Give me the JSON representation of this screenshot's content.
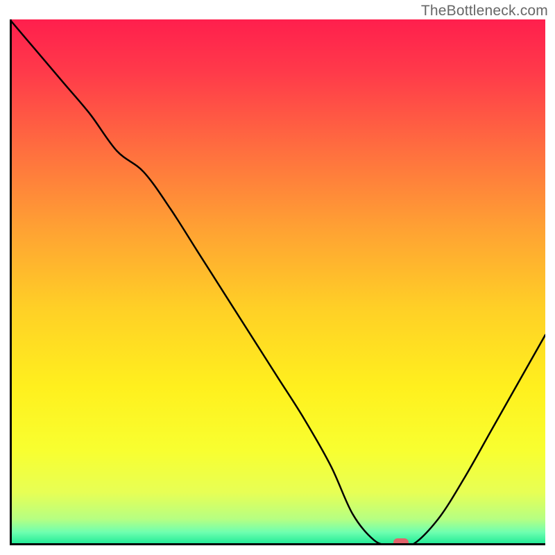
{
  "watermark": "TheBottleneck.com",
  "chart_data": {
    "type": "line",
    "title": "",
    "xlabel": "",
    "ylabel": "",
    "xlim": [
      0,
      100
    ],
    "ylim": [
      0,
      100
    ],
    "x": [
      0,
      5,
      10,
      15,
      20,
      25,
      30,
      35,
      40,
      45,
      50,
      55,
      60,
      64,
      68,
      71,
      75,
      80,
      85,
      90,
      95,
      100
    ],
    "values": [
      100,
      94,
      88,
      82,
      75,
      71,
      64,
      56,
      48,
      40,
      32,
      24,
      15,
      6,
      1,
      0,
      0,
      5,
      13,
      22,
      31,
      40
    ],
    "optimal_x": 73,
    "gradient_stops": [
      {
        "offset": 0.0,
        "color": "#ff1f4d"
      },
      {
        "offset": 0.1,
        "color": "#ff3a4a"
      },
      {
        "offset": 0.25,
        "color": "#ff6f3f"
      },
      {
        "offset": 0.4,
        "color": "#ffa233"
      },
      {
        "offset": 0.55,
        "color": "#ffd026"
      },
      {
        "offset": 0.7,
        "color": "#fff01e"
      },
      {
        "offset": 0.82,
        "color": "#f8ff30"
      },
      {
        "offset": 0.9,
        "color": "#e7ff55"
      },
      {
        "offset": 0.95,
        "color": "#b6ff82"
      },
      {
        "offset": 0.975,
        "color": "#6fffb0"
      },
      {
        "offset": 1.0,
        "color": "#18e893"
      }
    ],
    "marker_color": "#e1636b",
    "curve_color": "#000000"
  }
}
